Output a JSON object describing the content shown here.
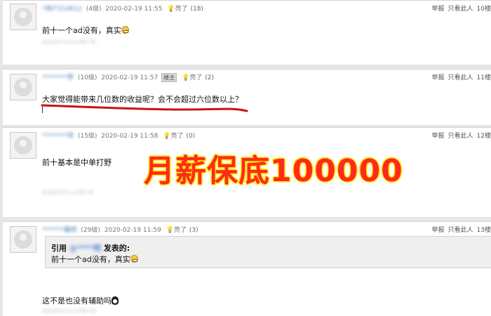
{
  "posts": [
    {
      "user": "*用户214612",
      "level": "(4级)",
      "time": "2020-02-19 11:55",
      "like_label": "亮了",
      "like_count": "(18)",
      "report": "举报",
      "only_view": "只看此人",
      "floor": "10楼",
      "content": "前十一个ad没有，真实",
      "client": "来自虎扑Android客户端"
    },
    {
      "user": "********梦",
      "level": "(10级)",
      "time": "2020-02-19 11:57",
      "owner_badge": "楼主",
      "like_label": "亮了",
      "like_count": "(2)",
      "report": "举报",
      "only_view": "只看此人",
      "floor": "11楼",
      "content": "大家觉得能带来几位数的收益呢？会不会超过六位数以上？"
    },
    {
      "user": "********场",
      "level": "(15级)",
      "time": "2020-02-19 11:58",
      "like_label": "亮了",
      "like_count": "(0)",
      "report": "举报",
      "only_view": "只看此人",
      "floor": "12楼",
      "content": "前十基本是中单打野",
      "client": "来自虎扑iPhone客户端"
    },
    {
      "user": "*******霸吧",
      "level": "(29级)",
      "time": "2020-02-19 11:59",
      "like_label": "亮了",
      "like_count": "(3)",
      "report": "举报",
      "only_view": "只看此人",
      "floor": "13楼",
      "quote_prefix": "引用",
      "quote_user": "@****明",
      "quote_suffix": "发表的:",
      "quote_body": "前十一个ad没有，真实",
      "content": "这不是也没有辅助吗",
      "client": "来自虎扑Android客户端"
    }
  ],
  "overlay_text": "月薪保底100000",
  "colors": {
    "overlay_fill": "#ff2a1a",
    "overlay_outline": "#ffe200",
    "username": "#4a7ab8",
    "underline": "#cc1111"
  }
}
